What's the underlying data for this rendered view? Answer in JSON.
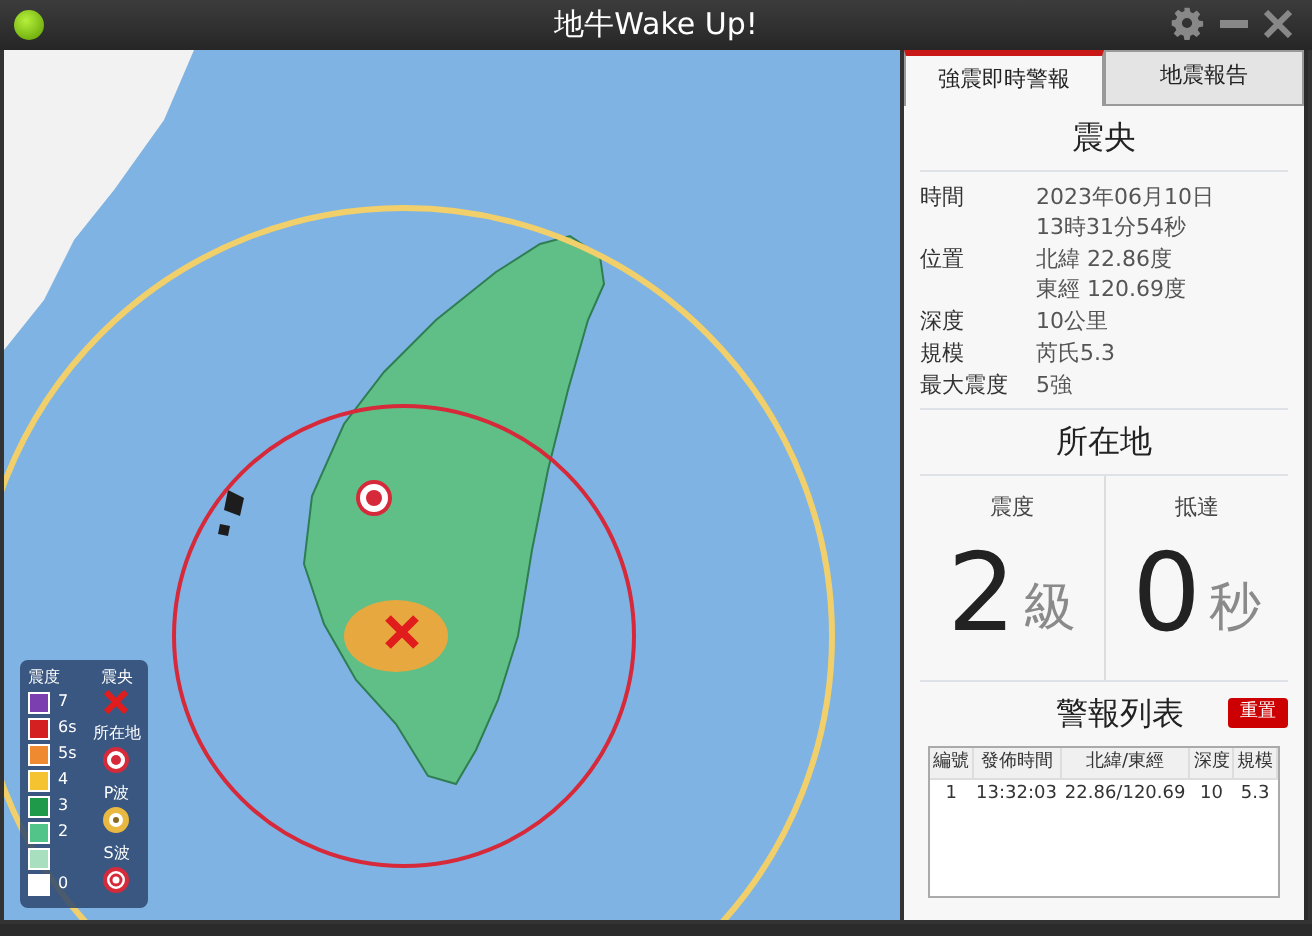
{
  "window": {
    "title": "地牛Wake Up!"
  },
  "map": {
    "legend": {
      "intensity_heading": "震度",
      "intensity_levels": [
        {
          "label": "7",
          "color": "#7b3fb0"
        },
        {
          "label": "6s",
          "color": "#d42020"
        },
        {
          "label": "5s",
          "color": "#f08a30"
        },
        {
          "label": "4",
          "color": "#f5c330"
        },
        {
          "label": "3",
          "color": "#1e9a4a"
        },
        {
          "label": "2",
          "color": "#52c48a"
        },
        {
          "color": "#a8e0bf"
        },
        {
          "label": "0",
          "color": "#ffffff"
        }
      ],
      "symbols": [
        {
          "kind": "epicenter",
          "label": "震央"
        },
        {
          "kind": "location",
          "label": "所在地"
        },
        {
          "kind": "p_wave",
          "label": "P波"
        },
        {
          "kind": "s_wave",
          "label": "S波"
        }
      ]
    }
  },
  "tabs": [
    {
      "label": "強震即時警報",
      "selected": true
    },
    {
      "label": "地震報告",
      "selected": false
    }
  ],
  "epicenter": {
    "heading": "震央",
    "fields": [
      {
        "label": "時間",
        "lines": [
          "2023年06月10日",
          "13時31分54秒"
        ]
      },
      {
        "label": "位置",
        "lines": [
          "北緯 22.86度",
          "東經 120.69度"
        ]
      },
      {
        "label": "深度",
        "lines": [
          "10公里"
        ]
      },
      {
        "label": "規模",
        "lines": [
          "芮氏5.3"
        ]
      },
      {
        "label": "最大震度",
        "lines": [
          "5強"
        ]
      }
    ]
  },
  "location": {
    "heading": "所在地",
    "stats": [
      {
        "label": "震度",
        "value": "2",
        "unit": "級"
      },
      {
        "label": "抵達",
        "value": "0",
        "unit": "秒"
      }
    ]
  },
  "alerts": {
    "heading": "警報列表",
    "reset_button": "重置",
    "columns": [
      "編號",
      "發佈時間",
      "北緯/東經",
      "深度",
      "規模"
    ],
    "rows": [
      [
        "1",
        "13:32:03",
        "22.86/120.69",
        "10",
        "5.3"
      ]
    ]
  }
}
